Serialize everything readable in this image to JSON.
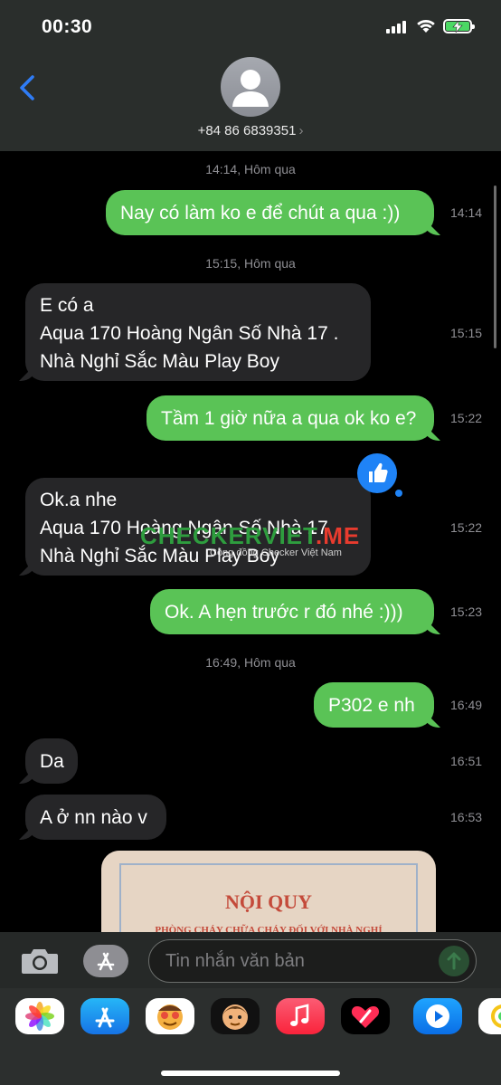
{
  "status_bar": {
    "time": "00:30"
  },
  "header": {
    "contact": "+84 86 6839351"
  },
  "messages": [
    {
      "stamp": "14:14, Hôm qua"
    },
    {
      "dir": "out",
      "text": "Nay có làm ko e để chút a qua :))",
      "time": "14:14"
    },
    {
      "stamp": "15:15, Hôm qua"
    },
    {
      "dir": "in",
      "lines": [
        "E có a",
        "Aqua 170 Hoàng Ngân Số Nhà 17 .",
        "Nhà Nghỉ Sắc Màu Play Boy"
      ],
      "time": "15:15"
    },
    {
      "dir": "out",
      "text": "Tầm 1 giờ nữa a qua ok ko e?",
      "time": "15:22"
    },
    {
      "dir": "in",
      "lines": [
        "Ok.a nhe",
        "Aqua 170 Hoàng Ngân Số Nhà 17",
        "Nhà Nghỉ Sắc Màu Play Boy"
      ],
      "time": "15:22",
      "tapback": "thumbs-up"
    },
    {
      "dir": "out",
      "text": "Ok. A hẹn trước r đó nhé :)))",
      "time": "15:23"
    },
    {
      "stamp": "16:49, Hôm qua"
    },
    {
      "dir": "out",
      "text": "P302 e nh",
      "time": "16:49"
    },
    {
      "dir": "in",
      "text": "Da",
      "time": "16:51"
    },
    {
      "dir": "in",
      "text": "A ở nn nào v",
      "time": "16:53"
    }
  ],
  "photo": {
    "title": "NỘI QUY",
    "subtitle": "PHÒNG CHÁY CHỮA CHÁY ĐỐI VỚI NHÀ NGHỈ"
  },
  "watermark": {
    "part1": "CHECKER",
    "part2": "VIET",
    "part3": ".ME",
    "sub": "Cộng đồng Checker Việt Nam"
  },
  "composer": {
    "placeholder": "Tin nhắn văn bản"
  },
  "dock_apps": [
    "photos-app",
    "app-store-app",
    "memoji-stickers-app",
    "animoji-app",
    "music-app",
    "digital-touch-app",
    "shazam-app",
    "fitness-app"
  ]
}
